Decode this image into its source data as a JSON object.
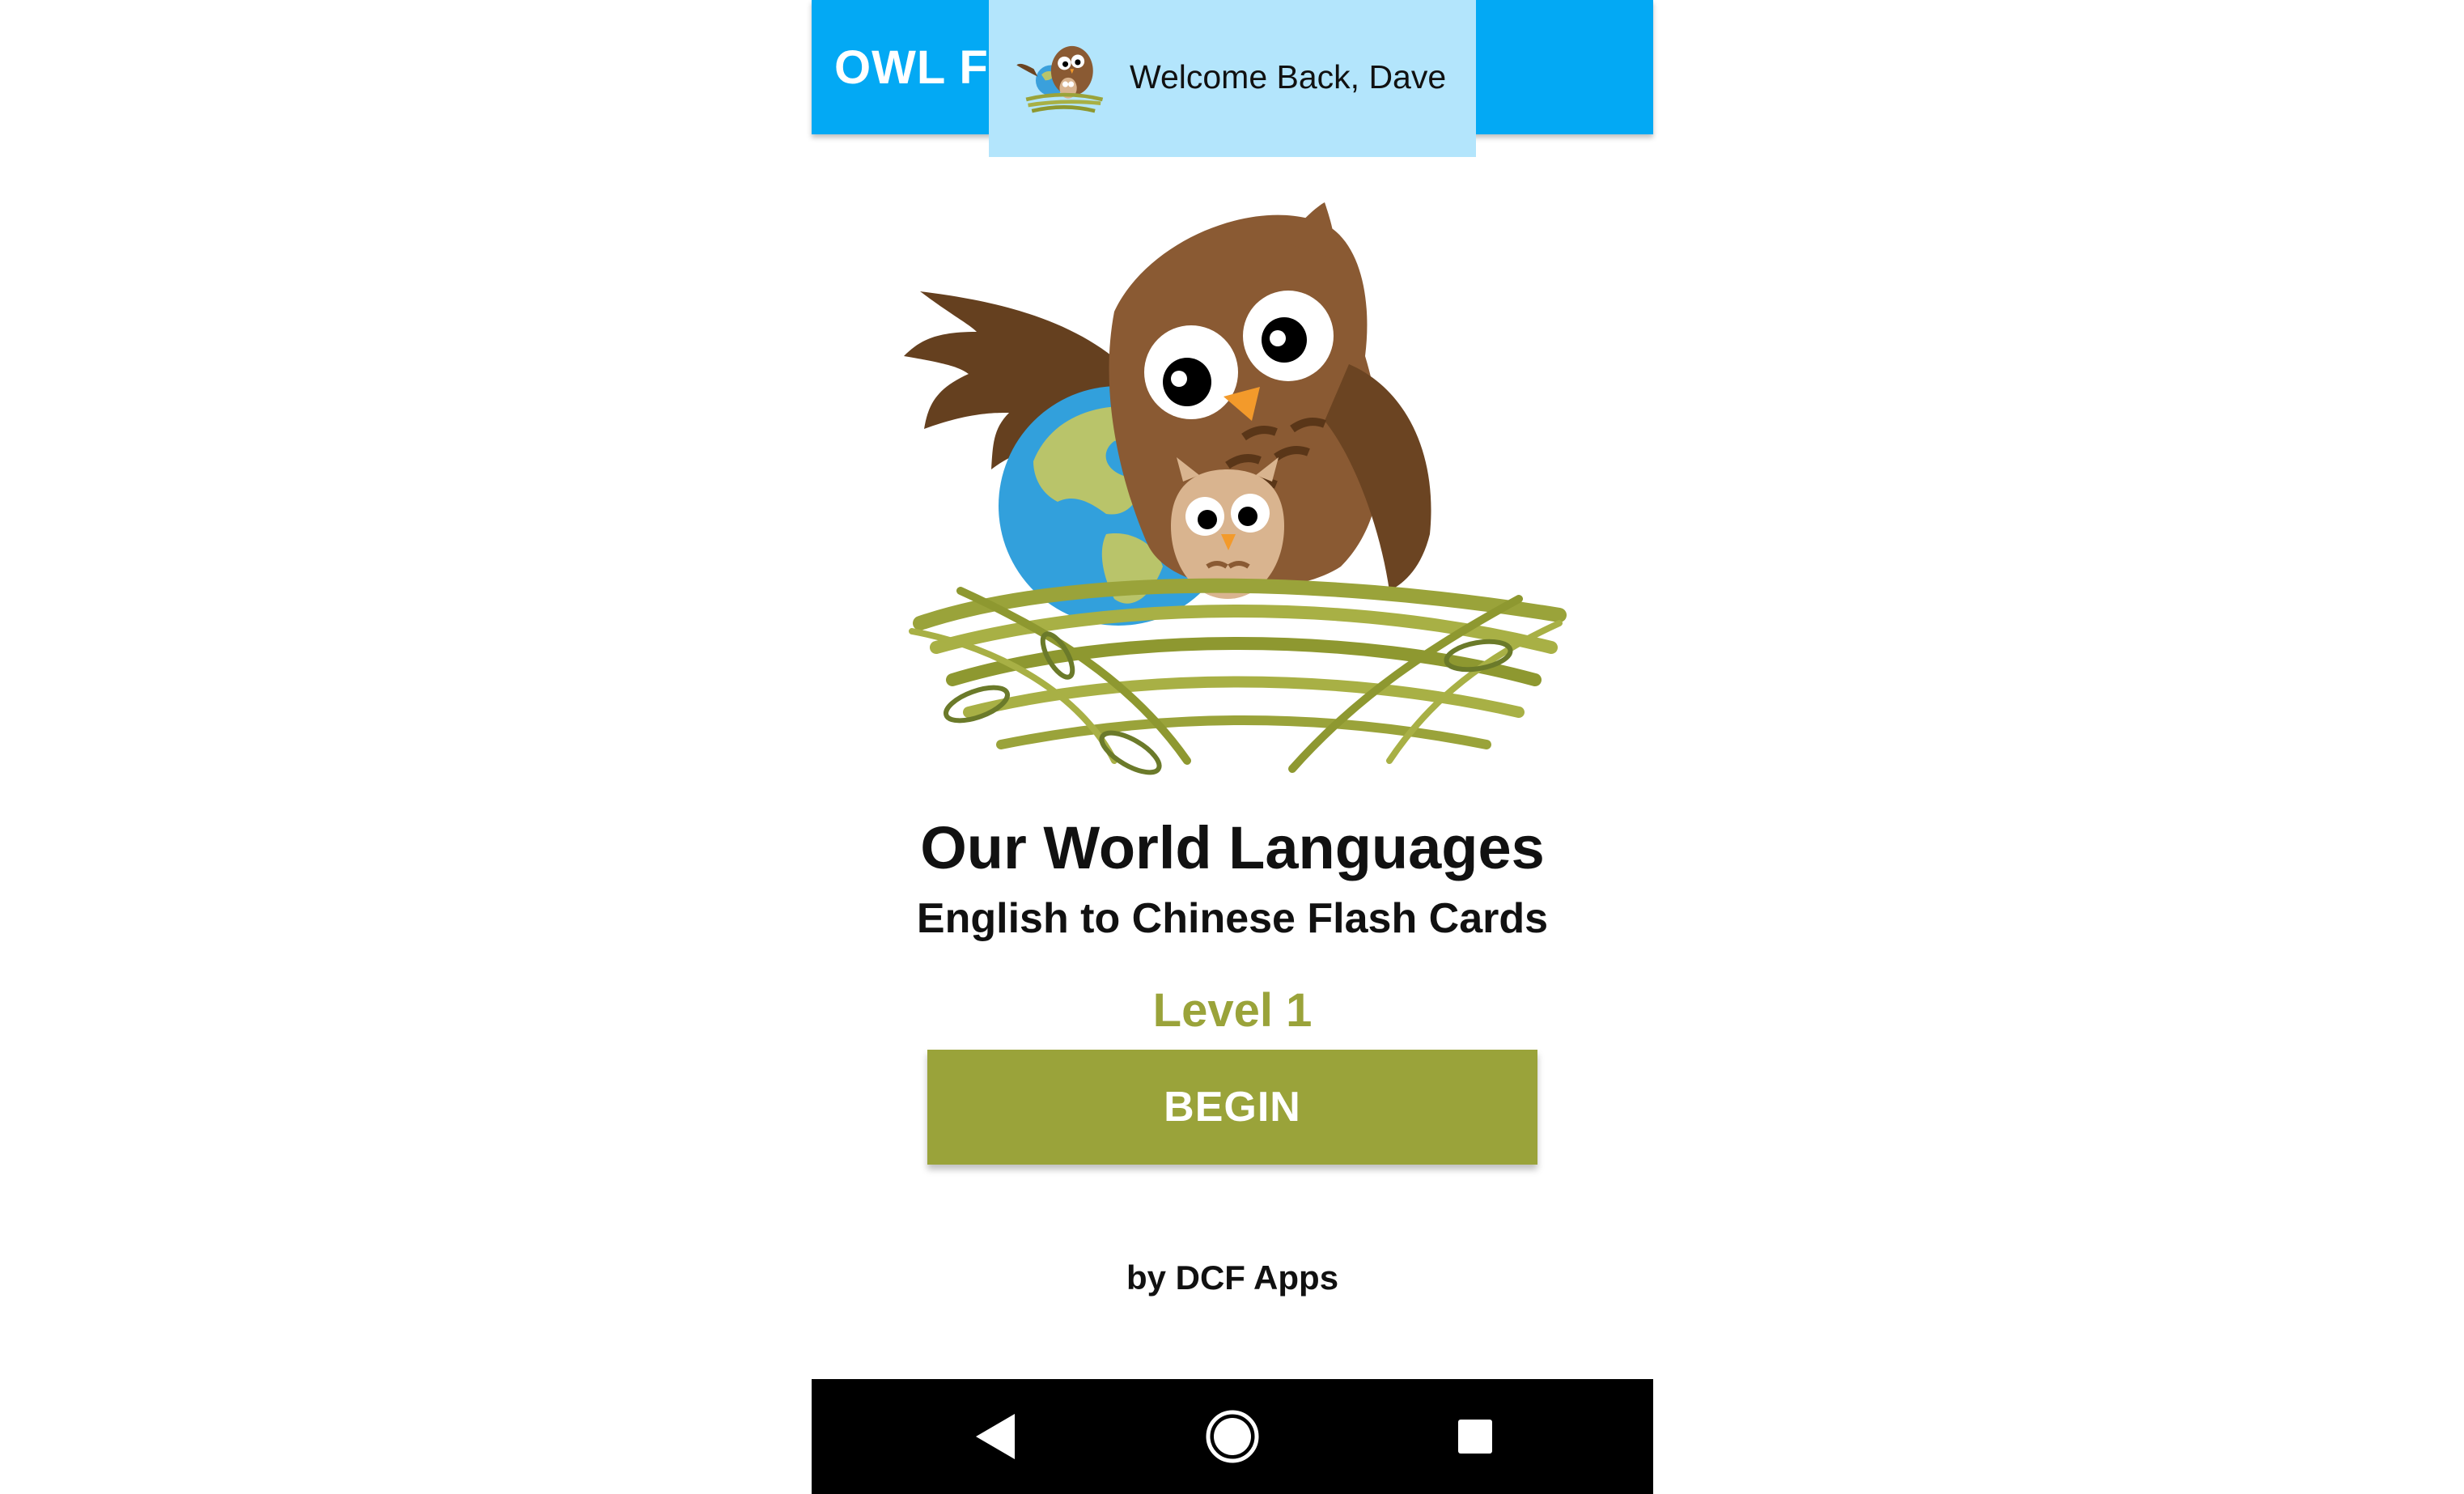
{
  "app_bar": {
    "title": "OWL FLASH CARDS",
    "color": "#03a9f4"
  },
  "toast": {
    "message": "Welcome Back, Dave",
    "background": "#b3e5fc"
  },
  "hero": {
    "icon": "owl-nest-globe-illustration"
  },
  "main": {
    "title": "Our World Languages",
    "subtitle": "English to Chinese Flash Cards",
    "level_label": "Level 1",
    "begin_label": "BEGIN",
    "accent_color": "#9aa33a",
    "credit": "by DCF Apps"
  },
  "navbar": {
    "back_icon": "back-triangle-icon",
    "home_icon": "home-circle-icon",
    "recents_icon": "recents-square-icon"
  }
}
